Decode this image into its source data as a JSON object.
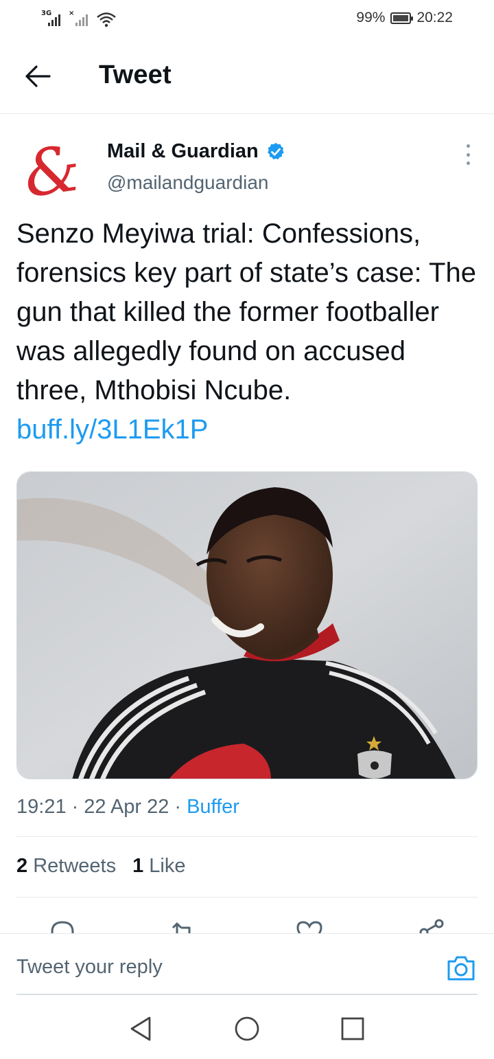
{
  "status_bar": {
    "network_1": "3G",
    "network_2": "×",
    "battery_percent": "99%",
    "time": "20:22",
    "icons": [
      "signal-icon",
      "signal-no-service-icon",
      "wifi-icon",
      "battery-charging-icon"
    ]
  },
  "header": {
    "title": "Tweet",
    "back_icon": "arrow-left-icon"
  },
  "tweet": {
    "author": {
      "avatar_glyph": "&",
      "name": "Mail & Guardian",
      "verified": true,
      "handle": "@mailandguardian"
    },
    "text": "Senzo Meyiwa trial: Confessions, forensics key part of state’s case: The gun that killed the former footballer was allegedly found on accused three, Mthobisi Ncube.",
    "link": "buff.ly/3L1Ek1P",
    "media": {
      "kind": "photo",
      "subject_icon": "photo-icon"
    },
    "meta": {
      "time": "19:21",
      "sep1": "·",
      "date": "22 Apr 22",
      "sep2": "·",
      "source": "Buffer"
    },
    "stats": {
      "retweets_count": "2",
      "retweets_label": "Retweets",
      "likes_count": "1",
      "likes_label": "Like"
    },
    "actions": [
      "reply-icon",
      "retweet-icon",
      "like-icon",
      "share-icon"
    ]
  },
  "reply": {
    "placeholder": "Tweet your reply",
    "camera_icon": "camera-icon"
  },
  "navbar": {
    "icons": [
      "nav-back-icon",
      "nav-home-icon",
      "nav-recents-icon"
    ]
  },
  "colors": {
    "accent": "#1d9bf0",
    "text": "#0f1419",
    "secondary": "#536471",
    "brand_red": "#d7282f"
  }
}
